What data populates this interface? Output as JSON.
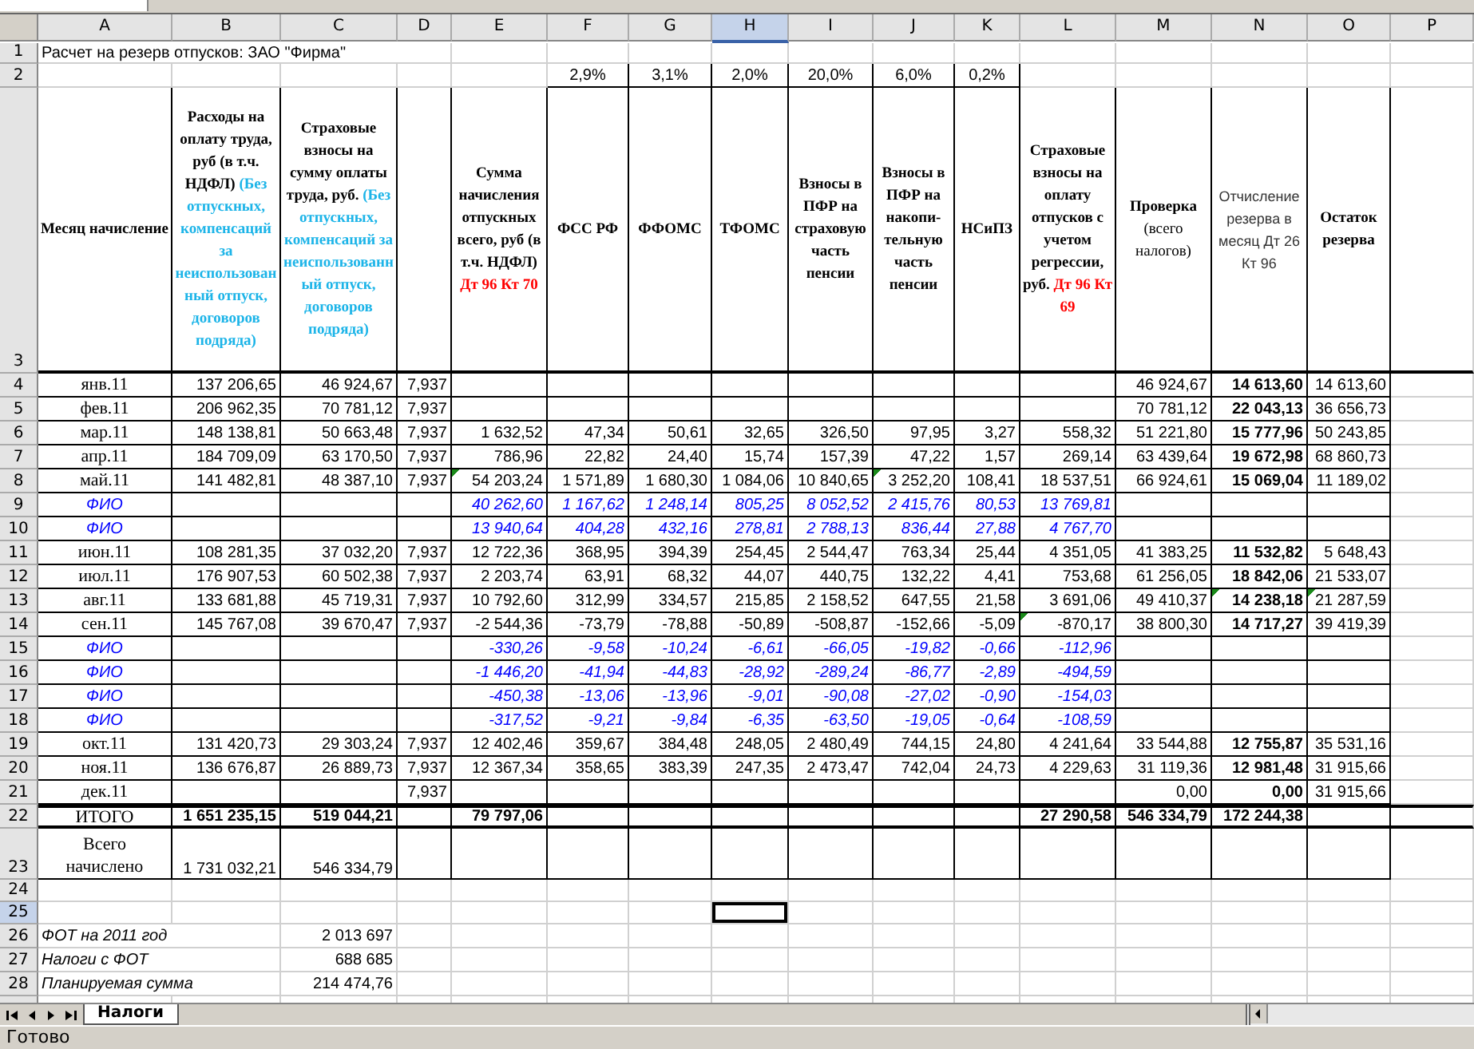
{
  "sheet": {
    "columns": [
      {
        "label": "A",
        "selected": false
      },
      {
        "label": "B",
        "selected": false
      },
      {
        "label": "C",
        "selected": false
      },
      {
        "label": "D",
        "selected": false
      },
      {
        "label": "E",
        "selected": false
      },
      {
        "label": "F",
        "selected": false
      },
      {
        "label": "G",
        "selected": false
      },
      {
        "label": "H",
        "selected": true
      },
      {
        "label": "I",
        "selected": false
      },
      {
        "label": "J",
        "selected": false
      },
      {
        "label": "K",
        "selected": false
      },
      {
        "label": "L",
        "selected": false
      },
      {
        "label": "M",
        "selected": false
      },
      {
        "label": "N",
        "selected": false
      },
      {
        "label": "O",
        "selected": false
      },
      {
        "label": "P",
        "selected": false
      }
    ],
    "rows": [
      {
        "number": "1",
        "selected": false,
        "kind": "title",
        "cells": {
          "A": "Расчет на резерв отпусков: ЗАО \"Фирма\""
        }
      },
      {
        "number": "2",
        "selected": false,
        "kind": "rates",
        "cells": {
          "F": "2,9%",
          "G": "3,1%",
          "H": "2,0%",
          "I": "20,0%",
          "J": "6,0%",
          "K": "0,2%"
        }
      },
      {
        "number": "3",
        "selected": false,
        "kind": "header",
        "cells": {
          "A": {
            "kind": "bold",
            "title": "Месяц начисление"
          },
          "B": {
            "kind": "bold",
            "title": "Расходы на оплату труда, руб (в т.ч. НДФЛ)",
            "note": "(Без отпускных, компенсаций за неиспользованный отпуск, договоров подряда)"
          },
          "C": {
            "kind": "bold",
            "title": "Страховые взносы на сумму оплаты труда, руб.",
            "note": "(Без отпускных, компенсаций за неиспользованный отпуск, договоров подряда)"
          },
          "E": {
            "kind": "bold",
            "title": "Сумма начисления отпускных всего, руб (в т.ч. НДФЛ)",
            "account": "Дт 96 Кт 70"
          },
          "F": {
            "kind": "bold",
            "title": "ФСС РФ"
          },
          "G": {
            "kind": "bold",
            "title": "ФФОМС"
          },
          "H": {
            "kind": "bold",
            "title": "ТФОМС"
          },
          "I": {
            "kind": "bold",
            "title": "Взносы в ПФР на страховую часть пенсии"
          },
          "J": {
            "kind": "bold",
            "title": "Взносы в ПФР на накопи-тельную часть пенсии"
          },
          "K": {
            "kind": "bold",
            "title": "НСиПЗ"
          },
          "L": {
            "kind": "bold",
            "title": "Страховые взносы на оплату отпусков с учетом регрессии, руб.",
            "account": "Дт 96 Кт 69"
          },
          "M": {
            "kind": "bold",
            "title": "Проверка",
            "subtitle": "(всего налогов)"
          },
          "N": {
            "kind": "plain",
            "title": "Отчисление резерва в месяц Дт 26 Кт 96"
          },
          "O": {
            "kind": "bold",
            "title": "Остаток резерва"
          }
        }
      },
      {
        "number": "4",
        "selected": false,
        "kind": "month",
        "cells": {
          "A": "янв.11",
          "B": "137 206,65",
          "C": "46 924,67",
          "D": "7,937",
          "M": "46 924,67",
          "N": "14 613,60",
          "O": "14 613,60"
        }
      },
      {
        "number": "5",
        "selected": false,
        "kind": "month",
        "cells": {
          "A": "фев.11",
          "B": "206 962,35",
          "C": "70 781,12",
          "D": "7,937",
          "M": "70 781,12",
          "N": "22 043,13",
          "O": "36 656,73"
        }
      },
      {
        "number": "6",
        "selected": false,
        "kind": "month",
        "cells": {
          "A": "мар.11",
          "B": "148 138,81",
          "C": "50 663,48",
          "D": "7,937",
          "E": "1 632,52",
          "F": "47,34",
          "G": "50,61",
          "H": "32,65",
          "I": "326,50",
          "J": "97,95",
          "K": "3,27",
          "L": "558,32",
          "M": "51 221,80",
          "N": "15 777,96",
          "O": "50 243,85"
        }
      },
      {
        "number": "7",
        "selected": false,
        "kind": "month",
        "cells": {
          "A": "апр.11",
          "B": "184 709,09",
          "C": "63 170,50",
          "D": "7,937",
          "E": "786,96",
          "F": "22,82",
          "G": "24,40",
          "H": "15,74",
          "I": "157,39",
          "J": "47,22",
          "K": "1,57",
          "L": "269,14",
          "M": "63 439,64",
          "N": "19 672,98",
          "O": "68 860,73"
        }
      },
      {
        "number": "8",
        "selected": false,
        "kind": "month",
        "error_marks": {
          "E": true,
          "J": true
        },
        "cells": {
          "A": "май.11",
          "B": "141 482,81",
          "C": "48 387,10",
          "D": "7,937",
          "E": "54 203,24",
          "F": "1 571,89",
          "G": "1 680,30",
          "H": "1 084,06",
          "I": "10 840,65",
          "J": "3 252,20",
          "K": "108,41",
          "L": "18 537,51",
          "M": "66 924,61",
          "N": "15 069,04",
          "O": "11 189,02"
        }
      },
      {
        "number": "9",
        "selected": false,
        "kind": "person",
        "cells": {
          "A": "ФИО",
          "E": "40 262,60",
          "F": "1 167,62",
          "G": "1 248,14",
          "H": "805,25",
          "I": "8 052,52",
          "J": "2 415,76",
          "K": "80,53",
          "L": "13 769,81"
        }
      },
      {
        "number": "10",
        "selected": false,
        "kind": "person",
        "cells": {
          "A": "ФИО",
          "E": "13 940,64",
          "F": "404,28",
          "G": "432,16",
          "H": "278,81",
          "I": "2 788,13",
          "J": "836,44",
          "K": "27,88",
          "L": "4 767,70"
        }
      },
      {
        "number": "11",
        "selected": false,
        "kind": "month",
        "cells": {
          "A": "июн.11",
          "B": "108 281,35",
          "C": "37 032,20",
          "D": "7,937",
          "E": "12 722,36",
          "F": "368,95",
          "G": "394,39",
          "H": "254,45",
          "I": "2 544,47",
          "J": "763,34",
          "K": "25,44",
          "L": "4 351,05",
          "M": "41 383,25",
          "N": "11 532,82",
          "O": "5 648,43"
        }
      },
      {
        "number": "12",
        "selected": false,
        "kind": "month",
        "cells": {
          "A": "июл.11",
          "B": "176 907,53",
          "C": "60 502,38",
          "D": "7,937",
          "E": "2 203,74",
          "F": "63,91",
          "G": "68,32",
          "H": "44,07",
          "I": "440,75",
          "J": "132,22",
          "K": "4,41",
          "L": "753,68",
          "M": "61 256,05",
          "N": "18 842,06",
          "O": "21 533,07"
        }
      },
      {
        "number": "13",
        "selected": false,
        "kind": "month",
        "error_marks": {
          "N": true,
          "O": true
        },
        "cells": {
          "A": "авг.11",
          "B": "133 681,88",
          "C": "45 719,31",
          "D": "7,937",
          "E": "10 792,60",
          "F": "312,99",
          "G": "334,57",
          "H": "215,85",
          "I": "2 158,52",
          "J": "647,55",
          "K": "21,58",
          "L": "3 691,06",
          "M": "49 410,37",
          "N": "14 238,18",
          "O": "21 287,59"
        }
      },
      {
        "number": "14",
        "selected": false,
        "kind": "month",
        "error_marks": {
          "L": true
        },
        "cells": {
          "A": "сен.11",
          "B": "145 767,08",
          "C": "39 670,47",
          "D": "7,937",
          "E": "-2 544,36",
          "F": "-73,79",
          "G": "-78,88",
          "H": "-50,89",
          "I": "-508,87",
          "J": "-152,66",
          "K": "-5,09",
          "L": "-870,17",
          "M": "38 800,30",
          "N": "14 717,27",
          "O": "39 419,39"
        }
      },
      {
        "number": "15",
        "selected": false,
        "kind": "person",
        "cells": {
          "A": "ФИО",
          "E": "-330,26",
          "F": "-9,58",
          "G": "-10,24",
          "H": "-6,61",
          "I": "-66,05",
          "J": "-19,82",
          "K": "-0,66",
          "L": "-112,96"
        }
      },
      {
        "number": "16",
        "selected": false,
        "kind": "person",
        "cells": {
          "A": "ФИО",
          "E": "-1 446,20",
          "F": "-41,94",
          "G": "-44,83",
          "H": "-28,92",
          "I": "-289,24",
          "J": "-86,77",
          "K": "-2,89",
          "L": "-494,59"
        }
      },
      {
        "number": "17",
        "selected": false,
        "kind": "person",
        "cells": {
          "A": "ФИО",
          "E": "-450,38",
          "F": "-13,06",
          "G": "-13,96",
          "H": "-9,01",
          "I": "-90,08",
          "J": "-27,02",
          "K": "-0,90",
          "L": "-154,03"
        }
      },
      {
        "number": "18",
        "selected": false,
        "kind": "person",
        "cells": {
          "A": "ФИО",
          "E": "-317,52",
          "F": "-9,21",
          "G": "-9,84",
          "H": "-6,35",
          "I": "-63,50",
          "J": "-19,05",
          "K": "-0,64",
          "L": "-108,59"
        }
      },
      {
        "number": "19",
        "selected": false,
        "kind": "month",
        "cells": {
          "A": "окт.11",
          "B": "131 420,73",
          "C": "29 303,24",
          "D": "7,937",
          "E": "12 402,46",
          "F": "359,67",
          "G": "384,48",
          "H": "248,05",
          "I": "2 480,49",
          "J": "744,15",
          "K": "24,80",
          "L": "4 241,64",
          "M": "33 544,88",
          "N": "12 755,87",
          "O": "35 531,16"
        }
      },
      {
        "number": "20",
        "selected": false,
        "kind": "month",
        "cells": {
          "A": "ноя.11",
          "B": "136 676,87",
          "C": "26 889,73",
          "D": "7,937",
          "E": "12 367,34",
          "F": "358,65",
          "G": "383,39",
          "H": "247,35",
          "I": "2 473,47",
          "J": "742,04",
          "K": "24,73",
          "L": "4 229,63",
          "M": "31 119,36",
          "N": "12 981,48",
          "O": "31 915,66"
        }
      },
      {
        "number": "21",
        "selected": false,
        "kind": "month",
        "cells": {
          "A": "дек.11",
          "D": "7,937",
          "M": "0,00",
          "N": "0,00",
          "O": "31 915,66"
        }
      },
      {
        "number": "22",
        "selected": false,
        "kind": "total",
        "cells": {
          "A": "ИТОГО",
          "B": "1 651 235,15",
          "C": "519 044,21",
          "E": "79 797,06",
          "L": "27 290,58",
          "M": "546 334,79",
          "N": "172 244,38"
        }
      },
      {
        "number": "23",
        "selected": false,
        "kind": "summary",
        "cells": {
          "A": "Всего начислено",
          "B": "1 731 032,21",
          "C": "546 334,79"
        }
      },
      {
        "number": "24",
        "selected": false,
        "kind": "blank"
      },
      {
        "number": "25",
        "selected": true,
        "kind": "blank"
      },
      {
        "number": "26",
        "selected": false,
        "kind": "note",
        "cells": {
          "A": "ФОТ на 2011 год",
          "C": "2 013 697"
        }
      },
      {
        "number": "27",
        "selected": false,
        "kind": "note",
        "cells": {
          "A": "Налоги с ФОТ",
          "C": "688 685"
        }
      },
      {
        "number": "28",
        "selected": false,
        "kind": "note",
        "cells": {
          "A": "Планируемая сумма",
          "C": "214 474,76"
        }
      }
    ]
  },
  "sheet_tabs": [
    {
      "label": "Налоги",
      "selected": true
    }
  ],
  "status_bar": {
    "text": "Готово"
  }
}
